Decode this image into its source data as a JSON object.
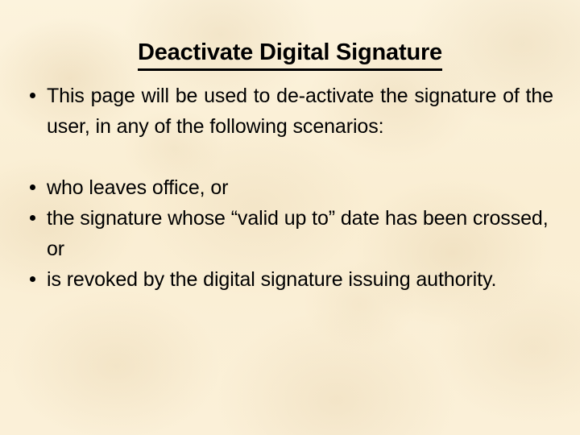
{
  "slide": {
    "title": "Deactivate Digital Signature",
    "background_color": "#fbf0d7",
    "text_color": "#000000",
    "bullet_groups": [
      {
        "id": "group-1",
        "items": [
          {
            "text": "This page will be used to de-activate the signature of the user, in any of the following scenarios:",
            "align": "justify",
            "bullet": "•"
          }
        ]
      },
      {
        "id": "group-2",
        "items": [
          {
            "text": "who leaves office, or",
            "align": "left",
            "bullet": "•"
          },
          {
            "text": "the signature whose “valid up to” date has been crossed, or",
            "align": "left",
            "bullet": "•"
          },
          {
            "text": "is revoked by the digital signature issuing authority.",
            "align": "justify",
            "bullet": "•"
          }
        ]
      }
    ]
  }
}
